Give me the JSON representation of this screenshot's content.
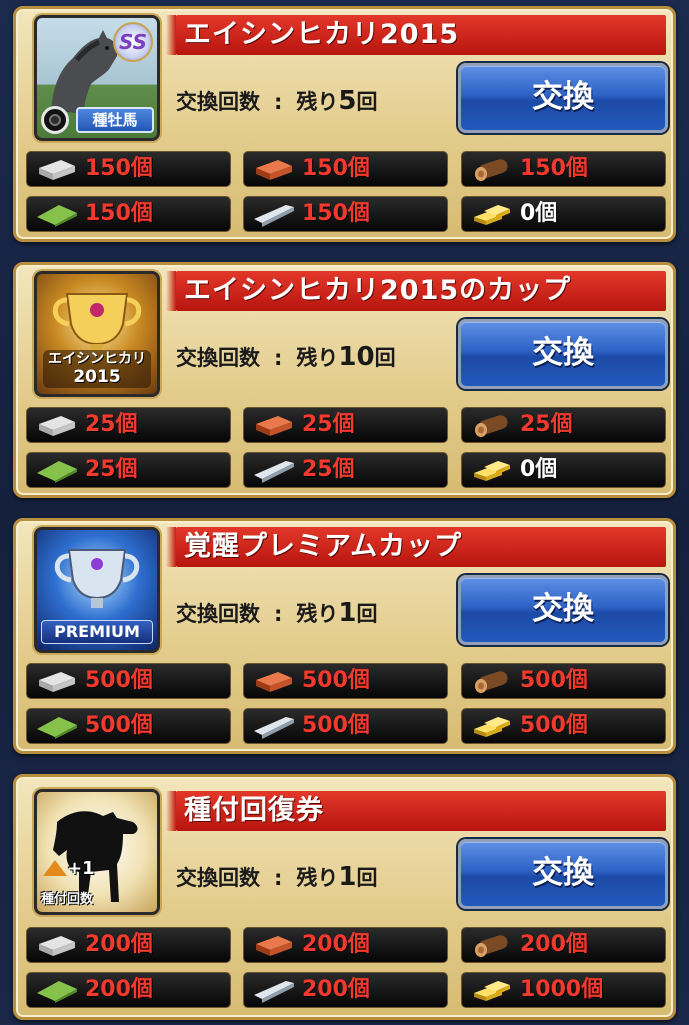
{
  "cards": [
    {
      "title": "エイシンヒカリ2015",
      "count_label": "交換回数",
      "sep": ":",
      "remaining_prefix": "残り",
      "remaining_value": "5",
      "remaining_unit": "回",
      "button_label": "交換",
      "thumb_badge": "SS",
      "thumb_label": "種牡馬",
      "materials": [
        {
          "icon": "concrete-block-icon",
          "value": "150個"
        },
        {
          "icon": "brick-icon",
          "value": "150個"
        },
        {
          "icon": "log-icon",
          "value": "150個"
        },
        {
          "icon": "turf-roll-icon",
          "value": "150個"
        },
        {
          "icon": "steel-beam-icon",
          "value": "150個"
        },
        {
          "icon": "gold-bar-icon",
          "value": "0個"
        }
      ]
    },
    {
      "title": "エイシンヒカリ2015のカップ",
      "count_label": "交換回数",
      "sep": ":",
      "remaining_prefix": "残り",
      "remaining_value": "10",
      "remaining_unit": "回",
      "button_label": "交換",
      "thumb_label": "エイシンヒカリ 2015",
      "thumb_label_1": "エイシンヒカリ",
      "thumb_label_2": "2015",
      "materials": [
        {
          "icon": "concrete-block-icon",
          "value": "25個"
        },
        {
          "icon": "brick-icon",
          "value": "25個"
        },
        {
          "icon": "log-icon",
          "value": "25個"
        },
        {
          "icon": "turf-roll-icon",
          "value": "25個"
        },
        {
          "icon": "steel-beam-icon",
          "value": "25個"
        },
        {
          "icon": "gold-bar-icon",
          "value": "0個"
        }
      ]
    },
    {
      "title": "覚醒プレミアムカップ",
      "count_label": "交換回数",
      "sep": ":",
      "remaining_prefix": "残り",
      "remaining_value": "1",
      "remaining_unit": "回",
      "button_label": "交換",
      "thumb_label": "PREMIUM",
      "materials": [
        {
          "icon": "concrete-block-icon",
          "value": "500個"
        },
        {
          "icon": "brick-icon",
          "value": "500個"
        },
        {
          "icon": "log-icon",
          "value": "500個"
        },
        {
          "icon": "turf-roll-icon",
          "value": "500個"
        },
        {
          "icon": "steel-beam-icon",
          "value": "500個"
        },
        {
          "icon": "gold-bar-icon",
          "value": "500個"
        }
      ]
    },
    {
      "title": "種付回復券",
      "count_label": "交換回数",
      "sep": ":",
      "remaining_prefix": "残り",
      "remaining_value": "1",
      "remaining_unit": "回",
      "button_label": "交換",
      "thumb_badge": "+1",
      "thumb_label": "種付回数",
      "materials": [
        {
          "icon": "concrete-block-icon",
          "value": "200個"
        },
        {
          "icon": "brick-icon",
          "value": "200個"
        },
        {
          "icon": "log-icon",
          "value": "200個"
        },
        {
          "icon": "turf-roll-icon",
          "value": "200個"
        },
        {
          "icon": "steel-beam-icon",
          "value": "200個"
        },
        {
          "icon": "gold-bar-icon",
          "value": "1000個"
        }
      ]
    }
  ],
  "colors": {
    "title_red": "#c51c12",
    "button_blue": "#2e63c6",
    "card_gold": "#e3cc8c",
    "material_red_text": "#f2392e",
    "material_zero_text": "#ffffff"
  }
}
